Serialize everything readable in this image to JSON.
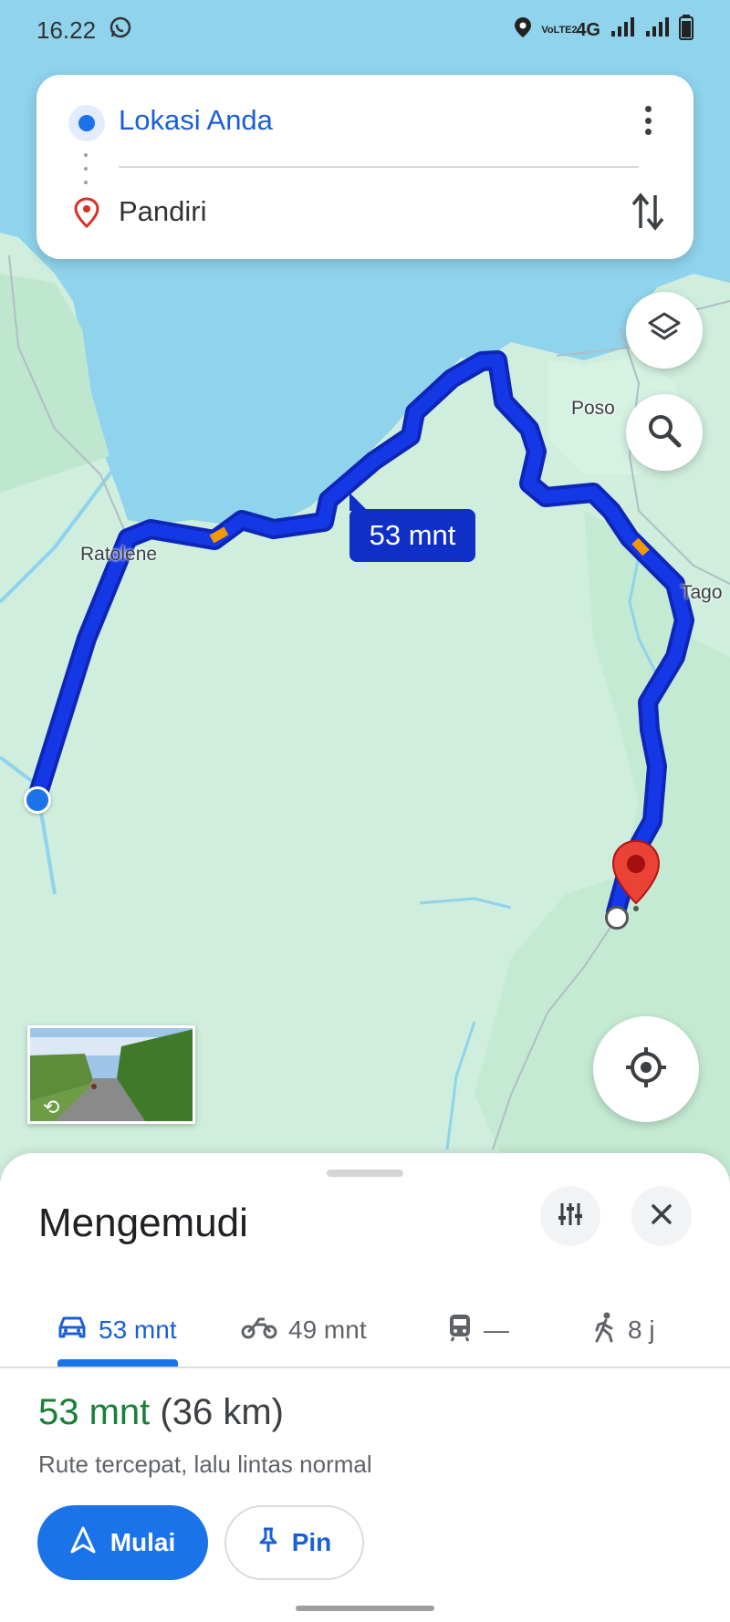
{
  "status_bar": {
    "time": "16.22",
    "network": "4G",
    "volte": "VoLTE2"
  },
  "directions": {
    "origin": "Lokasi Anda",
    "destination": "Pandiri"
  },
  "map": {
    "route_time_label": "53 mnt",
    "places": [
      "Poso",
      "Ratolene",
      "Tago"
    ],
    "colors": {
      "water": "#8fd3ec",
      "land": "#cfeedd",
      "route": "#1538e6",
      "route_border": "#0d26b8",
      "traffic_slow": "#f29900",
      "pin": "#ea4335"
    }
  },
  "sheet": {
    "title": "Mengemudi",
    "modes": [
      {
        "icon": "car-icon",
        "label": "53 mnt",
        "active": true
      },
      {
        "icon": "motorcycle-icon",
        "label": "49 mnt",
        "active": false
      },
      {
        "icon": "transit-icon",
        "label": "—",
        "active": false
      },
      {
        "icon": "walk-icon",
        "label": "8 j",
        "active": false
      }
    ],
    "summary_time": "53 mnt",
    "summary_distance": "(36 km)",
    "route_description": "Rute tercepat, lalu lintas normal",
    "start_button": "Mulai",
    "pin_button": "Pin"
  }
}
